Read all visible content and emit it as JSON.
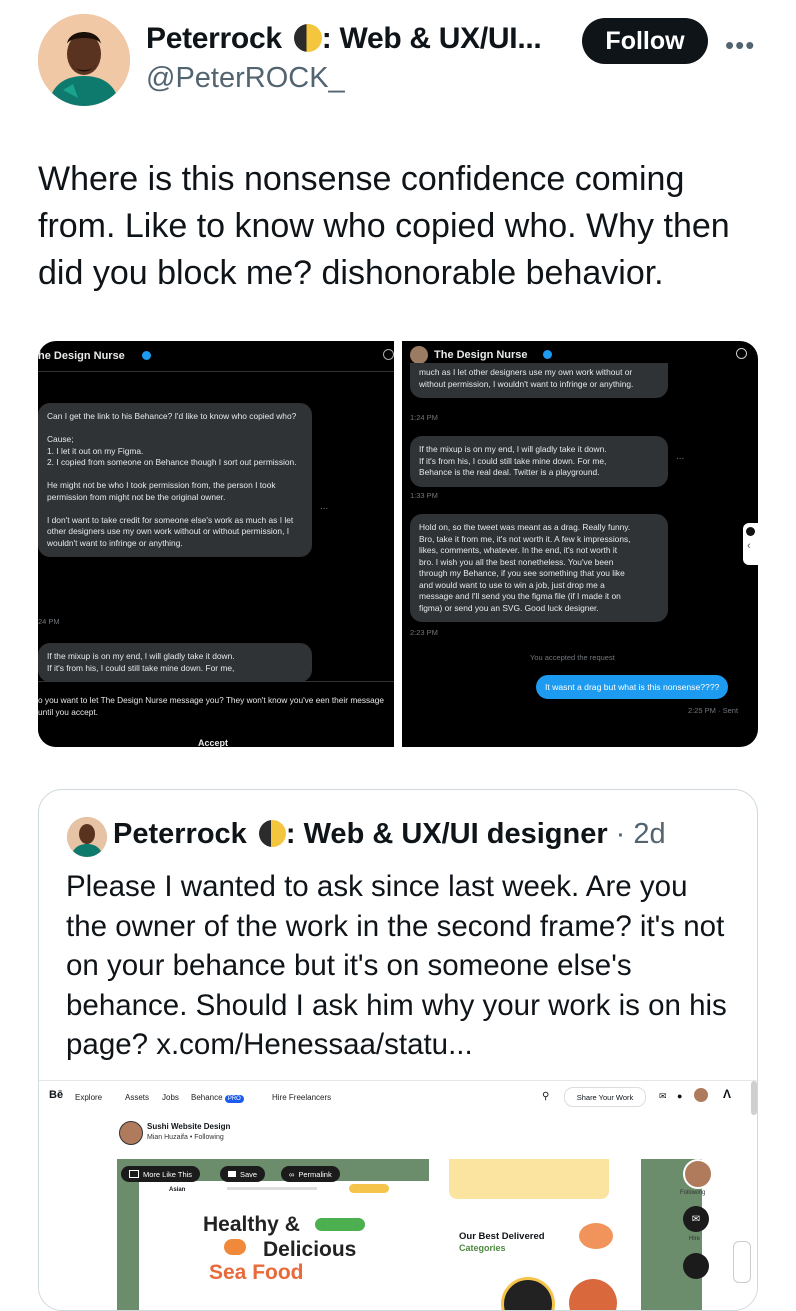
{
  "author": {
    "display_name": "Peterrock",
    "name_suffix": ": Web & UX/UI...",
    "handle": "@PeterROCK_"
  },
  "follow_label": "Follow",
  "more_label": "•••",
  "tweet_text": "Where is this nonsense confidence coming from. Like to know who copied who. Why then did you block me? dishonorable behavior.",
  "screenshot_left": {
    "header": "he Design Nurse",
    "message_1": "Can I get the link to his Behance? I'd like to know who copied who?\n\nCause;\n1. I let it out on my Figma.\n2. I copied from someone on Behance though I sort out permission.\n\nHe might not be who I took permission from, the person I took permission from might not be the original owner.\n\nI don't want to take credit for someone else's work as much as I let other designers use my own work without or without permission, I wouldn't want to infringe or anything.",
    "time_1": "24 PM",
    "message_2": "If the mixup is on my end, I will gladly take it down.\nIf it's from his, I could still take mine down. For me,",
    "request_text": "o you want to let The Design Nurse message you? They won't know you've een their message until you accept.",
    "accept_label": "Accept",
    "ellipsis": "..."
  },
  "screenshot_right": {
    "header": "The Design Nurse",
    "message_top": "much as I let other designers use my own work without or without permission, I wouldn't want to infringe or anything.",
    "time_1": "1:24 PM",
    "message_2": "If the mixup is on my end, I will gladly take it down.\nIf it's from his, I could still take mine down. For me,\nBehance is the real deal. Twitter is a playground.",
    "time_2": "1:33 PM",
    "message_3": "Hold on, so the tweet was meant as a drag. Really funny.\nBro, take it from me, it's not worth it. A few k impressions,\nlikes, comments, whatever. In the end, it's not worth it\nbro. I wish you all the best nonetheless. You've been\nthrough my Behance, if you see something that you like\nand would want to use to win a job, just drop me a\nmessage and I'll send you the figma file (if I made it on\nfigma) or send you an SVG. Good luck designer.",
    "time_3": "2:23 PM",
    "accepted_text": "You accepted the request",
    "my_message": "It wasnt a drag but what is this nonsense????",
    "sent_time": "2:25 PM · Sent",
    "ellipsis": "..."
  },
  "quote": {
    "display_name": "Peterrock",
    "name_suffix": ": Web & UX/UI designer",
    "date": "· 2d",
    "text": "Please I wanted to ask since last week. Are you the owner of the work in the second frame? it's not on your behance but it's on someone else's behance. Should I ask him why your work is on his page? x.com/Henessaa/statu...",
    "behance": {
      "logo": "Bē",
      "nav": [
        "Explore",
        "Assets",
        "Jobs",
        "Behance",
        "Hire Freelancers"
      ],
      "pro_badge": "PRO",
      "share_label": "Share Your Work",
      "project_title": "Sushi Website Design",
      "project_owner": "Mian Huzaifa",
      "following": "•  Following",
      "btn_more": "More Like This",
      "btn_save": "Save",
      "btn_permalink": "Permalink",
      "hero_label": "Asian",
      "hero_title_1": "Healthy &",
      "hero_title_2": "Delicious",
      "hero_title_3": "Sea Food",
      "categories_title": "Our Best Delivered",
      "categories_sub": "Categories",
      "side_following": "Following",
      "side_hire": "Hire"
    }
  },
  "colors": {
    "follow_bg": "#0f1419",
    "secondary_text": "#536471",
    "dm_bubble": "#2f3336",
    "dm_sent": "#1d9bf0",
    "behance_green": "#6b8d6c"
  }
}
